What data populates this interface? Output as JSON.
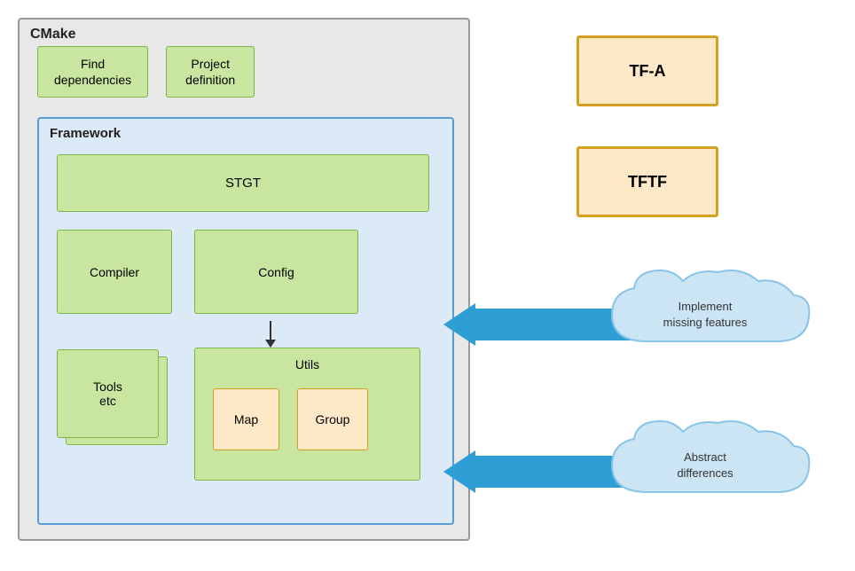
{
  "cmake": {
    "label": "CMake",
    "find_dependencies": "Find\ndependencies",
    "project_definition": "Project\ndefinition"
  },
  "framework": {
    "label": "Framework",
    "stgt": "STGT",
    "compiler": "Compiler",
    "config": "Config",
    "tools": "Tools\netc",
    "utils": "Utils",
    "map": "Map",
    "group": "Group"
  },
  "tfa": {
    "label": "TF-A"
  },
  "tftf": {
    "label": "TFTF"
  },
  "clouds": {
    "implement": "Implement\nmissing features",
    "abstract": "Abstract\ndifferences"
  }
}
